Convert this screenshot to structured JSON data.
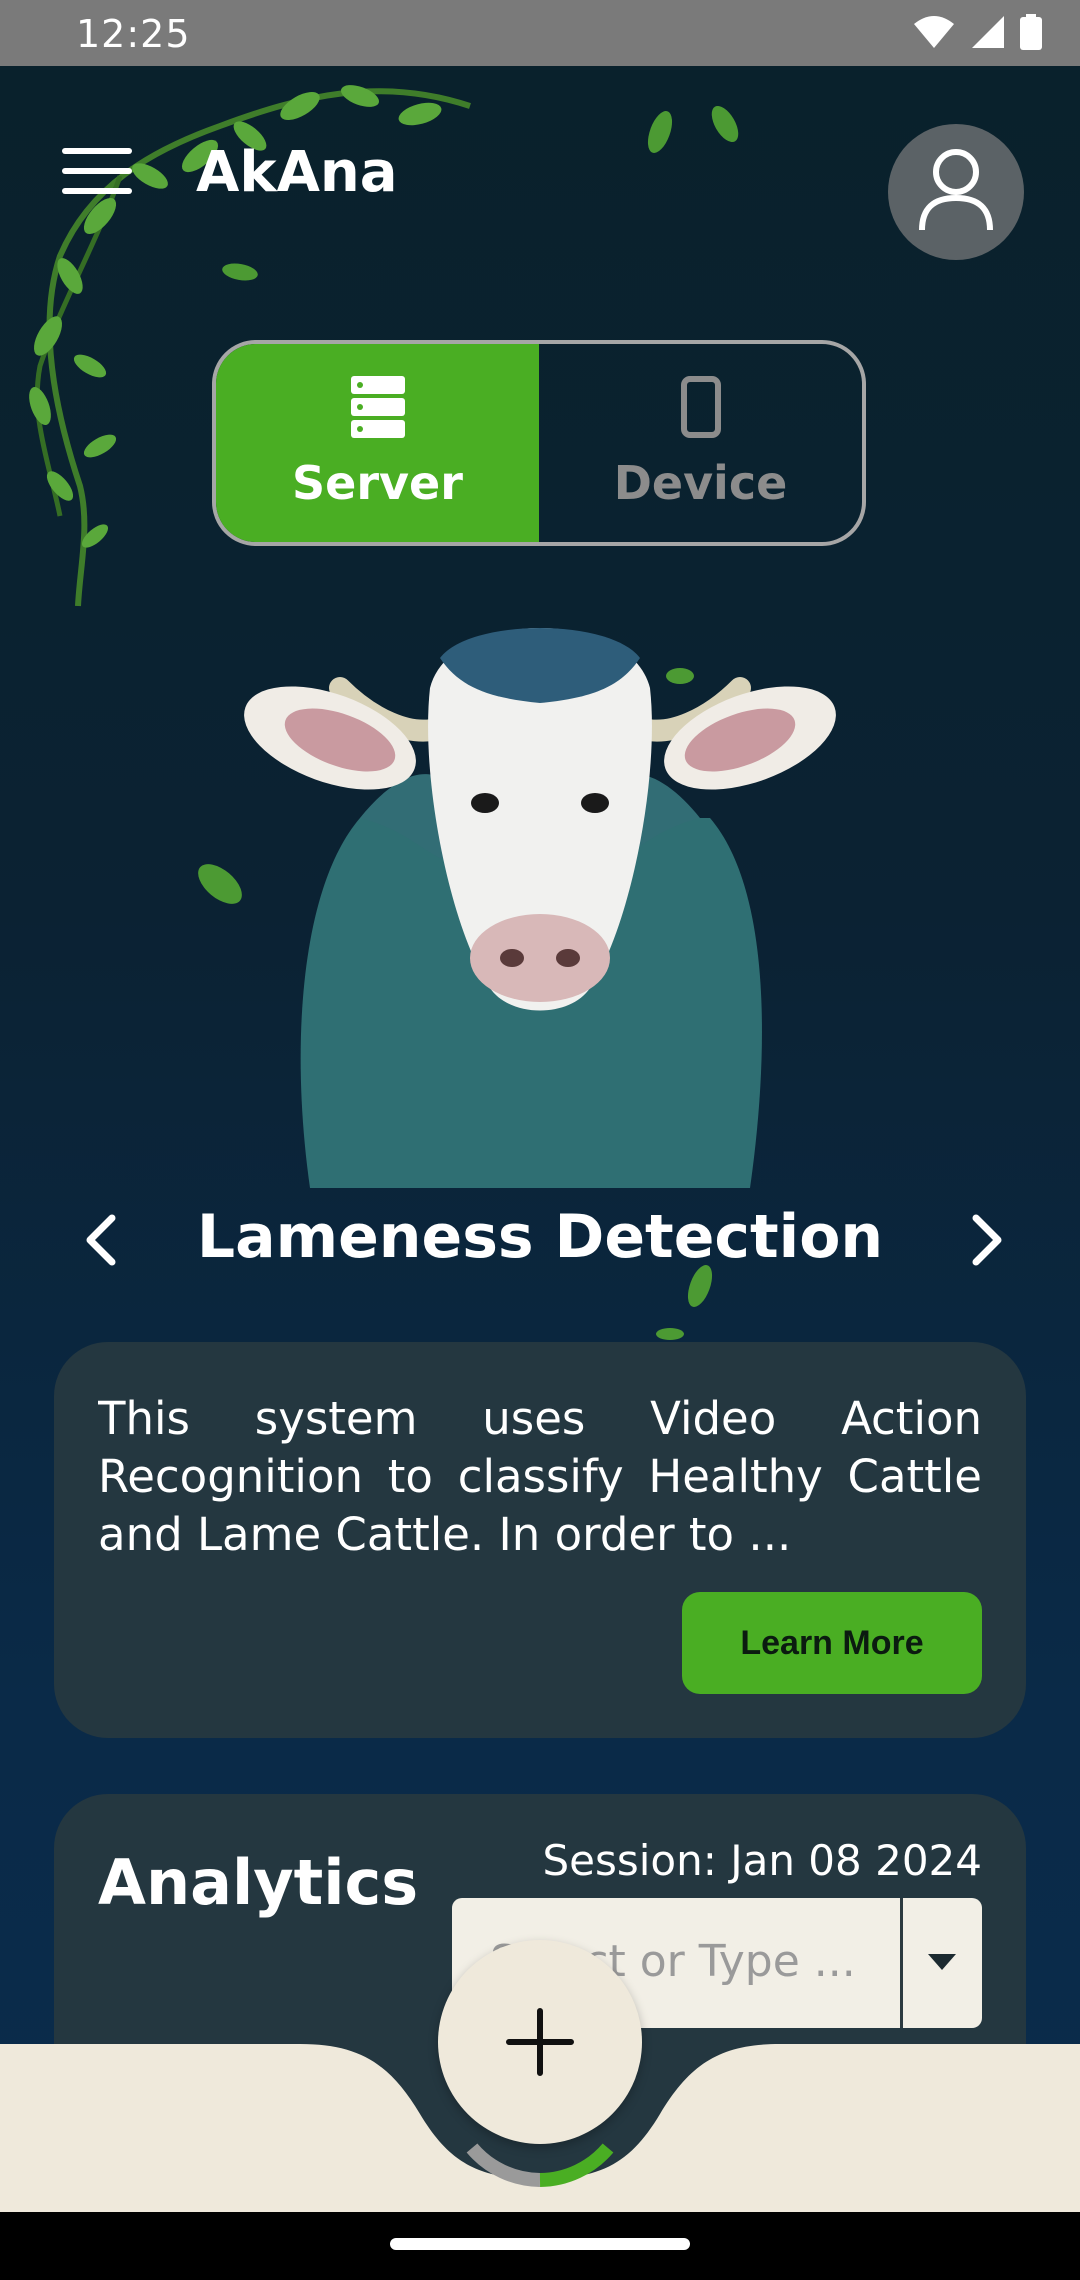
{
  "status_bar": {
    "time": "12:25"
  },
  "header": {
    "app_title": "AkAna"
  },
  "mode_toggle": {
    "options": [
      {
        "label": "Server",
        "icon": "server-icon",
        "selected": true
      },
      {
        "label": "Device",
        "icon": "phone-icon",
        "selected": false
      }
    ]
  },
  "carousel": {
    "feature_title": "Lameness Detection",
    "description": "This system uses Video Action Recognition to classify Healthy Cattle and Lame Cattle. In order to ...",
    "learn_more_label": "Learn More"
  },
  "analytics": {
    "title": "Analytics",
    "session_label": "Session: Jan 08 2024",
    "session_placeholder": "Select or Type ..."
  },
  "colors": {
    "accent_green": "#4aae23",
    "card_bg": "#243740",
    "bottom_bar_bg": "#efe9db"
  }
}
